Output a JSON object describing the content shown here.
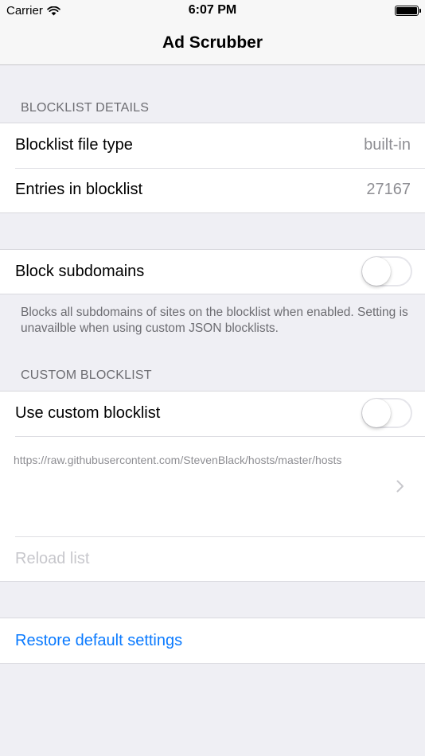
{
  "status_bar": {
    "carrier": "Carrier",
    "time": "6:07 PM",
    "wifi_icon": "wifi-icon",
    "battery_icon": "battery-full-icon",
    "battery_level": 1.0
  },
  "nav": {
    "title": "Ad Scrubber"
  },
  "blocklist_details": {
    "header": "BLOCKLIST DETAILS",
    "rows": [
      {
        "label": "Blocklist file type",
        "value": "built-in"
      },
      {
        "label": "Entries in blocklist",
        "value": "27167"
      }
    ]
  },
  "subdomains": {
    "label": "Block subdomains",
    "enabled": false,
    "footer": "Blocks all subdomains of sites on the blocklist when enabled. Setting is unavailble when using custom JSON blocklists."
  },
  "custom_blocklist": {
    "header": "CUSTOM BLOCKLIST",
    "use_label": "Use custom blocklist",
    "enabled": false,
    "url": "https://raw.githubusercontent.com/StevenBlack/hosts/master/hosts",
    "url_icon": "chevron-right-icon",
    "reload_label": "Reload list"
  },
  "restore": {
    "label": "Restore default settings"
  },
  "colors": {
    "background": "#efeff4",
    "link": "#0a7aff",
    "secondary_text": "#8e8e93",
    "header_text": "#6d6d72",
    "disabled_text": "#c7c7cc"
  }
}
